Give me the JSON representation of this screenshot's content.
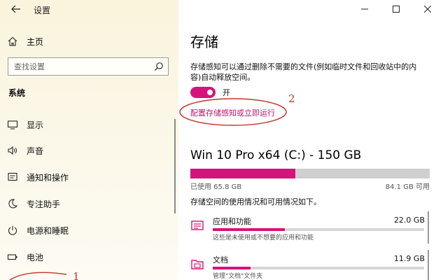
{
  "window": {
    "title": "设置"
  },
  "sidebar": {
    "home_label": "主页",
    "search_placeholder": "查找设置",
    "section_title": "系统",
    "items": [
      {
        "label": "显示",
        "icon": "monitor-icon"
      },
      {
        "label": "声音",
        "icon": "speaker-icon"
      },
      {
        "label": "通知和操作",
        "icon": "notification-icon"
      },
      {
        "label": "专注助手",
        "icon": "moon-icon"
      },
      {
        "label": "电源和睡眠",
        "icon": "power-icon"
      },
      {
        "label": "电池",
        "icon": "battery-icon"
      }
    ]
  },
  "main": {
    "title": "存储",
    "description": "存储感知可以通过删除不需要的文件(例如临时文件和回收站中的内容)自动释放空间。",
    "toggle": {
      "state": "on",
      "label": "开"
    },
    "config_link": "配置存储感知或立即运行",
    "drive": {
      "title": "Win 10 Pro x64 (C:) - 150 GB",
      "used_label": "已使用 65.8 GB",
      "available_label": "84.1 GB 可用",
      "used_fraction": 0.44
    },
    "usage_description": "存储空间的使用情况和可用情况如下。",
    "categories": [
      {
        "name": "应用和功能",
        "size": "22.0 GB",
        "description": "这些是未使用或不想要的应用和功能",
        "fraction": 0.34,
        "icon": "apps-icon"
      },
      {
        "name": "文档",
        "size": "11.9 GB",
        "description": "管理\"文档\"文件夹",
        "fraction": 0.18,
        "icon": "documents-icon"
      }
    ]
  },
  "annotations": {
    "marker_1": "1",
    "marker_2": "2",
    "color": "#c0362c"
  },
  "colors": {
    "accent": "#d6137a",
    "link": "#c4126e"
  }
}
